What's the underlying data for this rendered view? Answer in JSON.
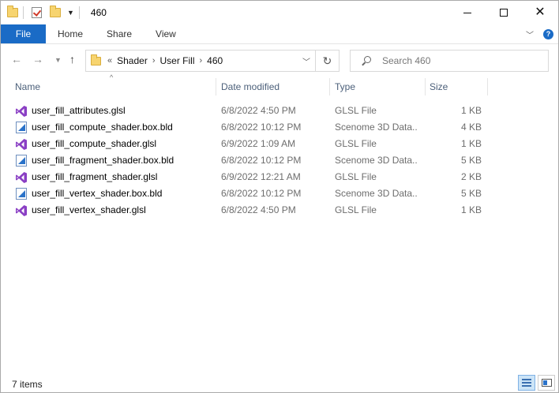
{
  "window": {
    "title": "460"
  },
  "ribbon": {
    "tabs": [
      "File",
      "Home",
      "Share",
      "View"
    ]
  },
  "navigation": {
    "breadcrumbs": [
      "Shader",
      "User Fill",
      "460"
    ],
    "overflow_chevron": "«",
    "search_placeholder": "Search 460"
  },
  "columns": {
    "name": "Name",
    "date": "Date modified",
    "type": "Type",
    "size": "Size"
  },
  "files": [
    {
      "name": "user_fill_attributes.glsl",
      "date": "6/8/2022 4:50 PM",
      "type": "GLSL File",
      "size": "1 KB",
      "icon": "visual-studio-icon"
    },
    {
      "name": "user_fill_compute_shader.box.bld",
      "date": "6/8/2022 10:12 PM",
      "type": "Scenome 3D Data...",
      "size": "4 KB",
      "icon": "scenome-file-icon"
    },
    {
      "name": "user_fill_compute_shader.glsl",
      "date": "6/9/2022 1:09 AM",
      "type": "GLSL File",
      "size": "1 KB",
      "icon": "visual-studio-icon"
    },
    {
      "name": "user_fill_fragment_shader.box.bld",
      "date": "6/8/2022 10:12 PM",
      "type": "Scenome 3D Data...",
      "size": "5 KB",
      "icon": "scenome-file-icon"
    },
    {
      "name": "user_fill_fragment_shader.glsl",
      "date": "6/9/2022 12:21 AM",
      "type": "GLSL File",
      "size": "2 KB",
      "icon": "visual-studio-icon"
    },
    {
      "name": "user_fill_vertex_shader.box.bld",
      "date": "6/8/2022 10:12 PM",
      "type": "Scenome 3D Data...",
      "size": "5 KB",
      "icon": "scenome-file-icon"
    },
    {
      "name": "user_fill_vertex_shader.glsl",
      "date": "6/8/2022 4:50 PM",
      "type": "GLSL File",
      "size": "1 KB",
      "icon": "visual-studio-icon"
    }
  ],
  "status": {
    "item_count": "7 items"
  },
  "colors": {
    "file_tab": "#1a6bc6",
    "column_header_text": "#4c607a",
    "vs_purple": "#8a3fc4",
    "scenome_blue": "#2a72c9"
  }
}
